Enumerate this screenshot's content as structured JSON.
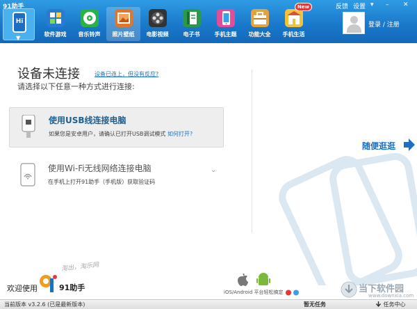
{
  "app": {
    "title": "91助手"
  },
  "window": {
    "feedback": "反馈",
    "settings": "设置",
    "minimize": "▾",
    "restore": "–",
    "close": "✕"
  },
  "nav": {
    "home_label": "Hi",
    "items": [
      {
        "label": "软件游戏",
        "color": "#2a7ad0"
      },
      {
        "label": "音乐铃声",
        "color": "#2bb04a"
      },
      {
        "label": "照片壁纸",
        "color": "#e0762b"
      },
      {
        "label": "电影视频",
        "color": "#333333"
      },
      {
        "label": "电子书",
        "color": "#2a9a4a"
      },
      {
        "label": "手机主题",
        "color": "#e24c9b"
      },
      {
        "label": "功能大全",
        "color": "#e8a23a"
      },
      {
        "label": "手机生活",
        "color": "#f2c23b"
      }
    ],
    "new_badge": "New"
  },
  "user": {
    "login_text": "登录 / 注册"
  },
  "main": {
    "title": "设备未连接",
    "connected_link": "设备已连上，但没有反应?",
    "subtitle": "请选择以下任意一种方式进行连接:",
    "usb": {
      "title": "使用USB线连接电脑",
      "desc": "如果您是安卓用户，请确认已打开USB调试模式",
      "link": "如何打开?"
    },
    "wifi": {
      "title": "使用Wi-Fi无线网络连接电脑",
      "desc": "在手机上打开91助手（手机版）获取验证码"
    },
    "stroll": "随便逛逛"
  },
  "footer": {
    "welcome": "欢迎使用",
    "logo_name": "91助手",
    "slogan": "淘出，淘乐网",
    "platform_text": "iOS/Android 平台轻松搞定"
  },
  "watermark": {
    "title": "当下软件园",
    "subtitle": "www.downxia.com"
  },
  "status": {
    "version": "当前版本 v3.2.6 (已是最新版本)",
    "task_status": "暂无任务",
    "task_center": "任务中心"
  }
}
